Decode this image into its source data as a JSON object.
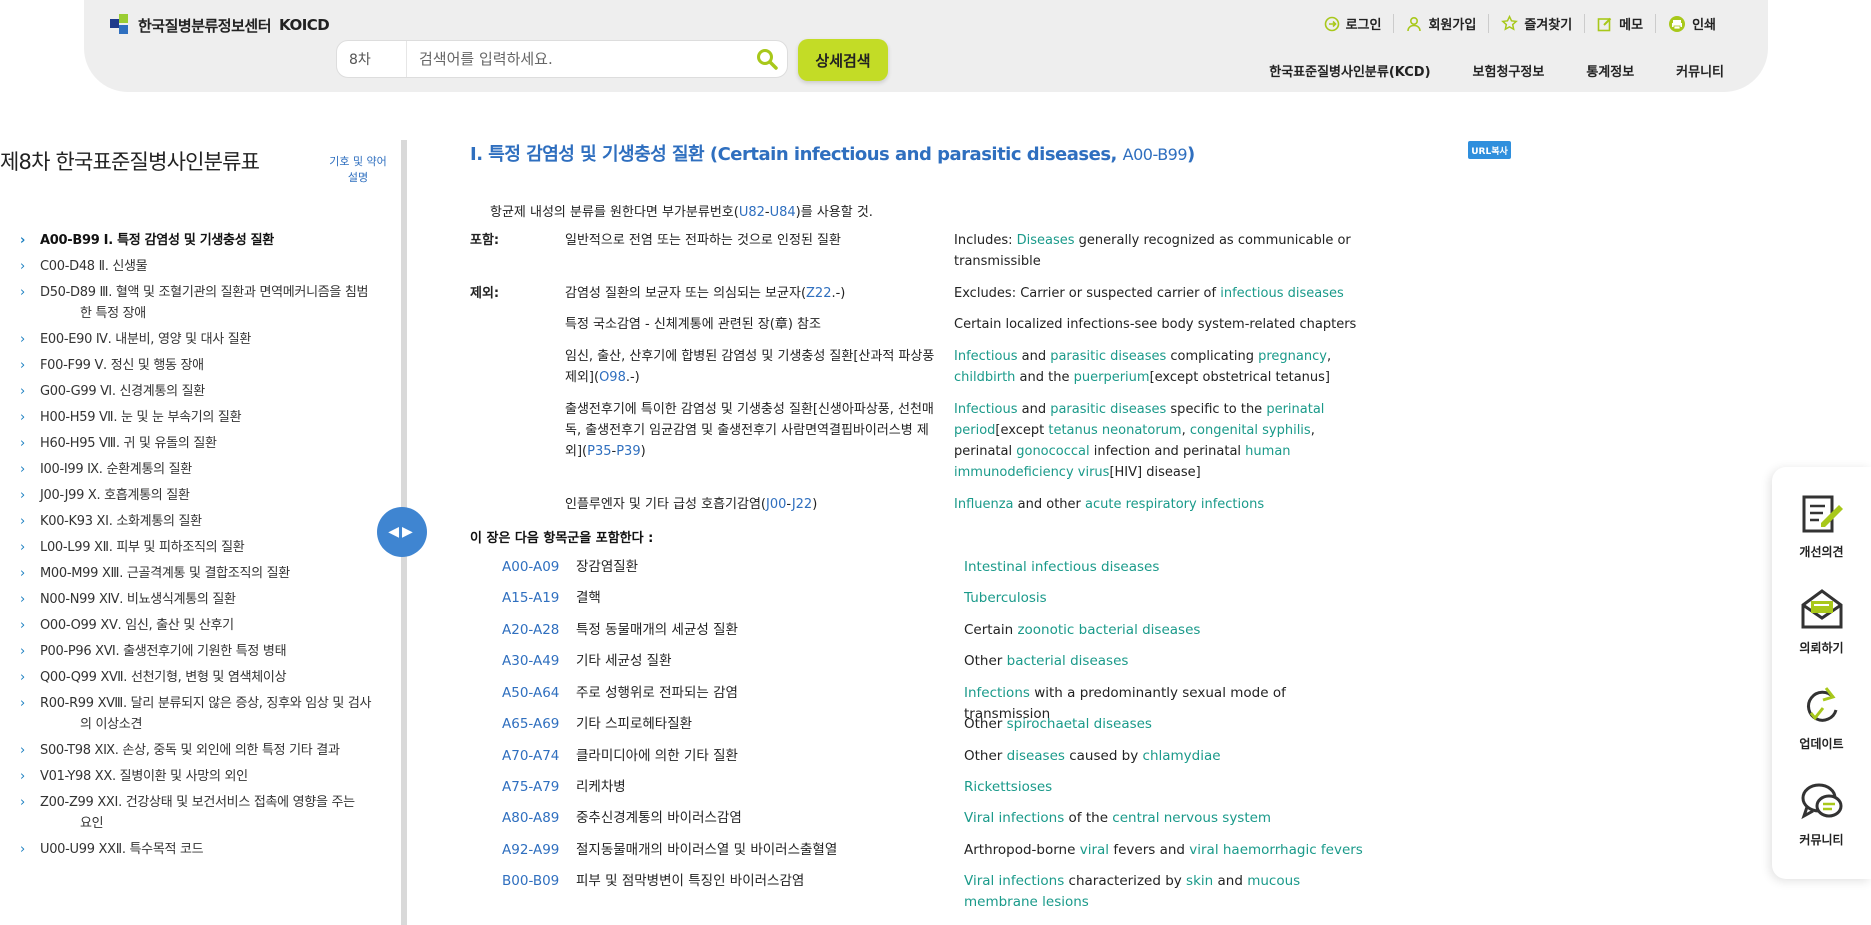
{
  "header": {
    "logo_text": "한국질병분류정보센터",
    "logo_en": "KOICD",
    "edition": "8차",
    "search_placeholder": "검색어를 입력하세요.",
    "detail_search": "상세검색",
    "util": [
      "로그인",
      "회원가입",
      "즐겨찾기",
      "메모",
      "인쇄"
    ],
    "gnb": [
      "한국표준질병사인분류(KCD)",
      "보험청구정보",
      "통계정보",
      "커뮤니티"
    ]
  },
  "sidebar": {
    "title": "제8차 한국표준질병사인분류표",
    "legend": [
      "기호 및 약어",
      "설명"
    ],
    "toggle": "◀▶",
    "items": [
      {
        "label": "A00-B99 I. 특정 감염성 및 기생충성 질환",
        "sub": ""
      },
      {
        "label": "C00-D48 Ⅱ. 신생물",
        "sub": ""
      },
      {
        "label": "D50-D89 Ⅲ. 혈액 및 조혈기관의 질환과 면역메커니즘을 침범",
        "sub": "한 특정 장애"
      },
      {
        "label": "E00-E90 Ⅳ. 내분비, 영양 및 대사 질환",
        "sub": ""
      },
      {
        "label": "F00-F99 Ⅴ. 정신 및 행동 장애",
        "sub": ""
      },
      {
        "label": "G00-G99 Ⅵ. 신경계통의 질환",
        "sub": ""
      },
      {
        "label": "H00-H59 Ⅶ. 눈 및 눈 부속기의 질환",
        "sub": ""
      },
      {
        "label": "H60-H95 Ⅷ. 귀 및 유돌의 질환",
        "sub": ""
      },
      {
        "label": "I00-I99 Ⅸ. 순환계통의 질환",
        "sub": ""
      },
      {
        "label": "J00-J99 Ⅹ. 호흡계통의 질환",
        "sub": ""
      },
      {
        "label": "K00-K93 ⅩⅠ. 소화계통의 질환",
        "sub": ""
      },
      {
        "label": "L00-L99 ⅩⅡ. 피부 및 피하조직의 질환",
        "sub": ""
      },
      {
        "label": "M00-M99 ⅩⅢ. 근골격계통 및 결합조직의 질환",
        "sub": ""
      },
      {
        "label": "N00-N99 ⅩⅣ. 비뇨생식계통의 질환",
        "sub": ""
      },
      {
        "label": "O00-O99 ⅩⅤ. 임신, 출산 및 산후기",
        "sub": ""
      },
      {
        "label": "P00-P96 ⅩⅥ. 출생전후기에 기원한 특정 병태",
        "sub": ""
      },
      {
        "label": "Q00-Q99 ⅩⅦ. 선천기형, 변형 및 염색체이상",
        "sub": ""
      },
      {
        "label": "R00-R99 ⅩⅧ. 달리 분류되지 않은 증상, 징후와 임상 및 검사",
        "sub": "의 이상소견"
      },
      {
        "label": "S00-T98 ⅩⅨ. 손상, 중독 및 외인에 의한 특정 기타 결과",
        "sub": ""
      },
      {
        "label": "V01-Y98 ⅩⅩ. 질병이환 및 사망의 외인",
        "sub": ""
      },
      {
        "label": "Z00-Z99 ⅩⅩⅠ. 건강상태 및 보건서비스 접촉에 영향을 주는",
        "sub": "요인"
      },
      {
        "label": "U00-U99 ⅩⅩⅡ. 특수목적 코드",
        "sub": ""
      }
    ]
  },
  "chapter": {
    "title_ko": "I. 특정 감염성 및 기생충성 질환",
    "title_en": "(Certain infectious and parasitic diseases,",
    "code_a": "A00",
    "dash": "-",
    "code_b": "B99",
    "close": ")",
    "url_copy": "URL복사",
    "note_pre": "항균제 내성의 분류를 원한다면 부가분류번호(",
    "note_c1": "U82",
    "note_c2": "U84",
    "note_post": ")를 사용할 것.",
    "incl_label": "포함:",
    "incl_ko": "일반적으로 전염 또는 전파하는 것으로 인정된 질환",
    "incl_en_pre": "Includes: ",
    "incl_en_link": "Diseases",
    "incl_en_post": " generally recognized as communicable or transmissible",
    "excl_label": "제외:",
    "ex1_ko_pre": "감염성 질환의 보균자 또는 의심되는 보균자(",
    "ex1_ko_code": "Z22",
    "ex1_ko_post": ".-)",
    "ex1_en_pre": "Excludes: Carrier or suspected carrier of ",
    "ex1_en_link": "infectious diseases",
    "ex2_ko": "특정 국소감염 - 신체계통에 관련된 장(章) 참조",
    "ex2_en": "Certain localized infections-see body system-related chapters",
    "ex3_ko_pre": "임신, 출산, 산후기에 합병된 감염성 및 기생충성 질환[산과적 파상풍 제외](",
    "ex3_ko_code": "O98",
    "ex3_ko_post": ".-)",
    "ex3_en": [
      "Infectious",
      " and ",
      "parasitic diseases",
      " complicating ",
      "pregnancy",
      ", ",
      "childbirth",
      " and the ",
      "puerperium",
      "[except obstetrical tetanus]"
    ],
    "ex4_ko_pre": "출생전후기에 특이한 감염성 및 기생충성 질환[신생아파상풍, 선천매독, 출생전후기 임균감염 및 출생전후기 사람면역결핍바이러스병 제외](",
    "ex4_ko_c1": "P35",
    "ex4_ko_c2": "P39",
    "ex4_ko_post": ")",
    "ex4_en": [
      "Infectious",
      " and ",
      "parasitic diseases",
      " specific to the ",
      "perinatal period",
      "[except ",
      "tetanus neonatorum",
      ", ",
      "congenital syphilis",
      ", perinatal ",
      "gonococcal",
      " infection and perinatal ",
      "human immunodeficiency virus",
      "[HIV] disease]"
    ],
    "ex5_ko_pre": "인플루엔자 및 기타 급성 호흡기감염(",
    "ex5_ko_c1": "J00",
    "ex5_ko_c2": "J22",
    "ex5_ko_post": ")",
    "ex5_en": [
      "Influenza",
      " and other ",
      "acute respiratory infections"
    ],
    "contains": "이 장은 다음 항목군을 포함한다 :",
    "groups": [
      {
        "code": "A00-A09",
        "ko": "장감염질환",
        "en": [
          "Intestinal infectious diseases"
        ]
      },
      {
        "code": "A15-A19",
        "ko": "결핵",
        "en": [
          "Tuberculosis"
        ]
      },
      {
        "code": "A20-A28",
        "ko": "특정 동물매개의 세균성 질환",
        "en": [
          "Certain ",
          "zoonotic bacterial diseases"
        ]
      },
      {
        "code": "A30-A49",
        "ko": "기타 세균성 질환",
        "en": [
          "Other ",
          "bacterial diseases"
        ]
      },
      {
        "code": "A50-A64",
        "ko": "주로 성행위로 전파되는 감염",
        "en": [
          "Infections",
          " with a predominantly sexual mode of transmission"
        ]
      },
      {
        "code": "A65-A69",
        "ko": "기타 스피로헤타질환",
        "en": [
          "Other ",
          "spirochaetal diseases"
        ]
      },
      {
        "code": "A70-A74",
        "ko": "클라미디아에 의한 기타 질환",
        "en": [
          "Other ",
          "diseases",
          " caused by ",
          "chlamydiae"
        ]
      },
      {
        "code": "A75-A79",
        "ko": "리케차병",
        "en": [
          "Rickettsioses"
        ]
      },
      {
        "code": "A80-A89",
        "ko": "중추신경계통의 바이러스감염",
        "en": [
          "Viral infections",
          " of the ",
          "central nervous system"
        ]
      },
      {
        "code": "A92-A99",
        "ko": "절지동물매개의 바이러스열 및 바이러스출혈열",
        "en": [
          "Arthropod-borne ",
          "viral",
          " fevers and ",
          "viral haemorrhagic fevers"
        ]
      },
      {
        "code": "B00-B09",
        "ko": "피부 및 점막병변이 특징인 바이러스감염",
        "en": [
          "Viral infections",
          " characterized by ",
          "skin",
          " and ",
          "mucous membrane lesions"
        ]
      }
    ]
  },
  "float_menu": [
    "개선의견",
    "의뢰하기",
    "업데이트",
    "커뮤니티"
  ],
  "colors": {
    "accent_blue": "#2f6fbf",
    "link_green": "#1a9a8a",
    "lime": "#c3dc26"
  }
}
